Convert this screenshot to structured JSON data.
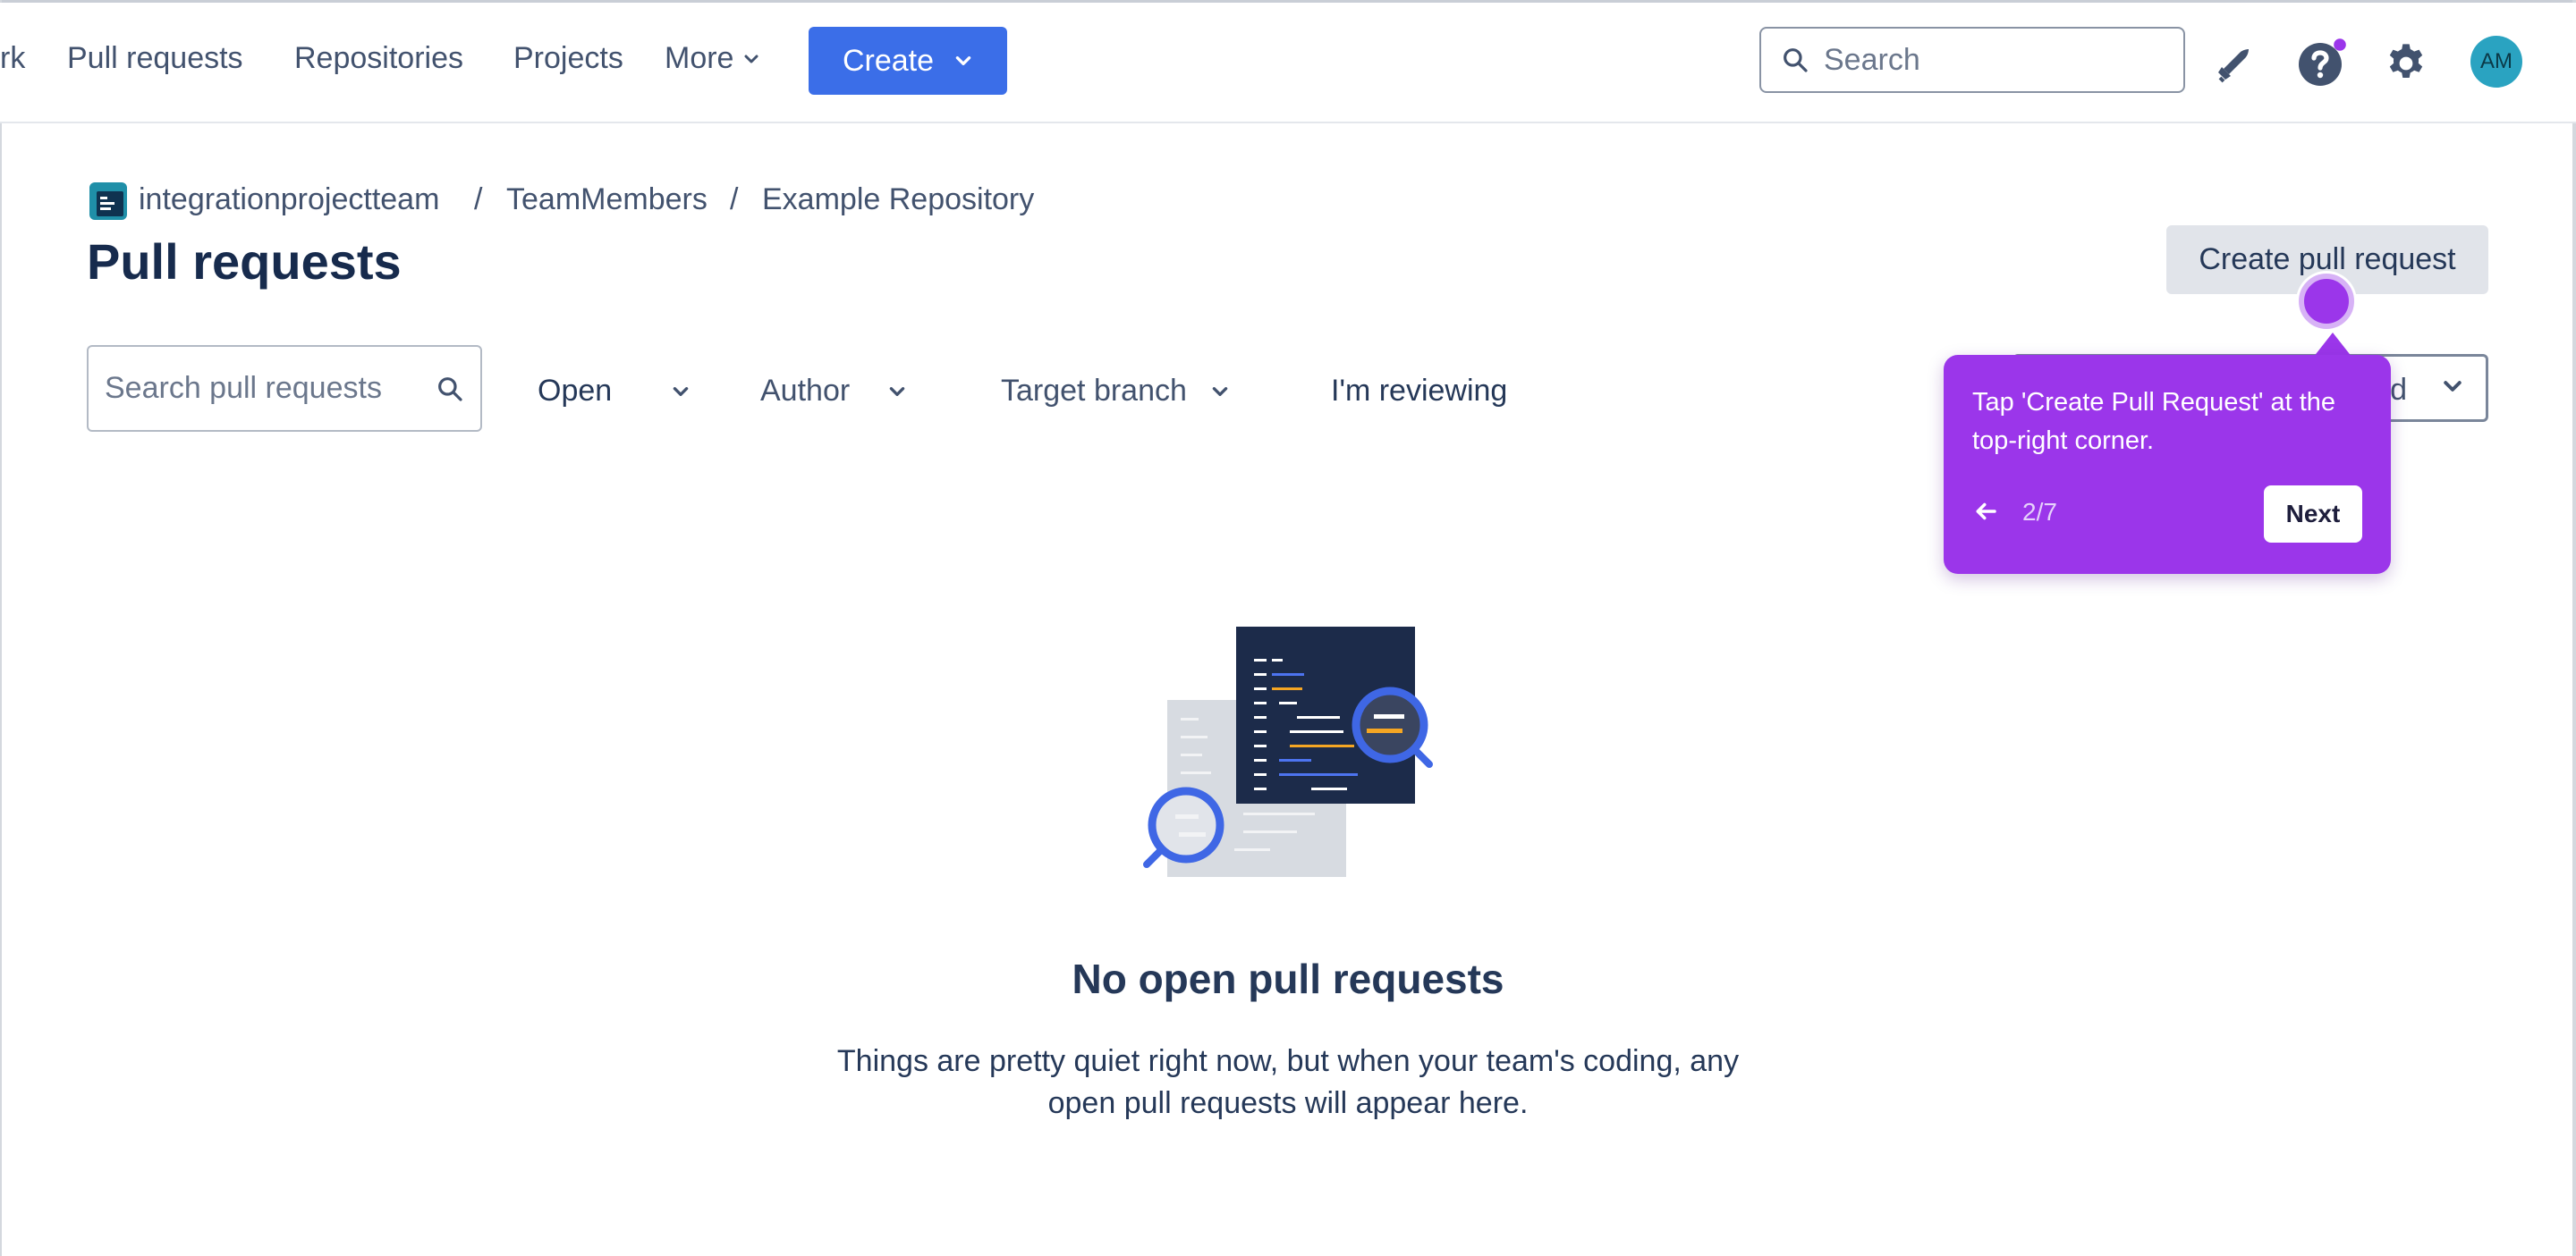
{
  "topnav": {
    "items": [
      "rk",
      "Pull requests",
      "Repositories",
      "Projects",
      "More"
    ],
    "create_label": "Create",
    "search_placeholder": "Search",
    "avatar_initials": "AM",
    "accent_color": "#3b6ee8"
  },
  "breadcrumb": {
    "items": [
      "integrationprojectteam",
      "TeamMembers",
      "Example Repository"
    ],
    "separator": "/"
  },
  "page": {
    "title": "Pull requests",
    "create_pr_label": "Create pull request"
  },
  "filters": {
    "search_placeholder": "Search pull requests",
    "status": "Open",
    "author": "Author",
    "target_branch": "Target branch",
    "reviewing": "I'm reviewing",
    "hidden_dropdown_partial": "d"
  },
  "tooltip": {
    "text": "Tap 'Create Pull Request' at the top-right corner.",
    "step": "2/7",
    "next_label": "Next",
    "color": "#9b36ea"
  },
  "empty_state": {
    "title": "No open pull requests",
    "line1": "Things are pretty quiet right now, but when your team's coding, any",
    "line2": "open pull requests will appear here."
  }
}
